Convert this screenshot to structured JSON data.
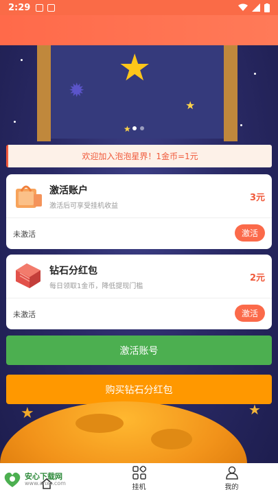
{
  "status_bar": {
    "time": "2:29"
  },
  "notice": {
    "text": "欢迎加入泡泡星界！1金币=1元"
  },
  "cards": [
    {
      "title": "激活账户",
      "desc": "激活后可享受挂机收益",
      "amount": "3元",
      "status": "未激活",
      "button": "激活"
    },
    {
      "title": "钻石分红包",
      "desc": "每日领取1金币，降低提现门槛",
      "amount": "2元",
      "status": "未激活",
      "button": "激活"
    }
  ],
  "buttons": {
    "activate_account": "激活账号",
    "buy_diamond": "购买钻石分红包"
  },
  "nav": {
    "items": [
      {
        "label": "",
        "icon": "home-icon"
      },
      {
        "label": "挂机",
        "icon": "grid-icon"
      },
      {
        "label": "我的",
        "icon": "user-icon"
      }
    ]
  },
  "watermark": {
    "name": "安心下载网",
    "url": "www.anxz.com"
  },
  "colors": {
    "accent": "#fb6a4a",
    "green_button": "#4caf50",
    "orange_button": "#ff9800",
    "amount": "#f0593a"
  }
}
